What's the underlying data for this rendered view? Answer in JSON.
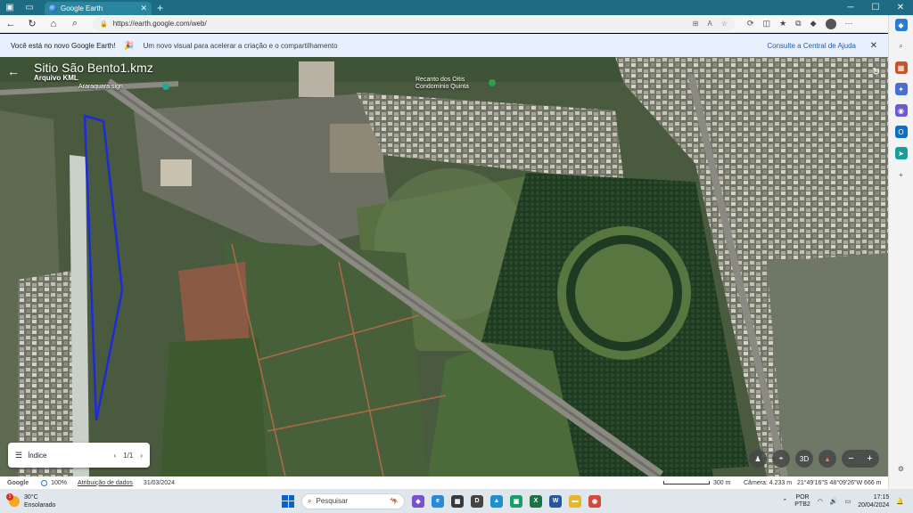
{
  "browser": {
    "tab_title": "Google Earth",
    "tab_close": "✕",
    "new_tab": "+",
    "url": "https://earth.google.com/web/"
  },
  "banner": {
    "title": "Você está no novo Google Earth!",
    "subtitle": "Um novo visual para acelerar a criação e o compartilhamento",
    "help_link": "Consulte a Central de Ajuda",
    "close": "✕"
  },
  "map": {
    "title": "Sitio São Bento1.kmz",
    "subtitle": "Arquivo KML",
    "poi_labels": [
      "Araraquara sign",
      "Recanto dos Oitis",
      "Condominio Quinta"
    ]
  },
  "index_panel": {
    "label": "Índice",
    "page": "1/1"
  },
  "controls": {
    "view3d_label": "3D",
    "zoom_out": "−",
    "zoom_in": "+"
  },
  "status": {
    "brand": "Google",
    "zoom_percent": "100%",
    "attribution": "Atribuição de dados",
    "date": "31/03/2024",
    "scale": "300 m",
    "camera": "Câmera: 4.233 m",
    "coords": "21°49'16\"S 48°09'26\"W  666 m"
  },
  "taskbar": {
    "temperature": "30°C",
    "weather": "Ensolarado",
    "weather_badge": "1",
    "search_placeholder": "Pesquisar",
    "lang_top": "POR",
    "lang_bottom": "PTB2",
    "time": "17:15",
    "date": "20/04/2024"
  },
  "colors": {
    "tabstrip": "#1e6c84",
    "banner": "#e8f0fe",
    "kml_outline": "#1d2bd9",
    "link": "#1a5bb8"
  }
}
